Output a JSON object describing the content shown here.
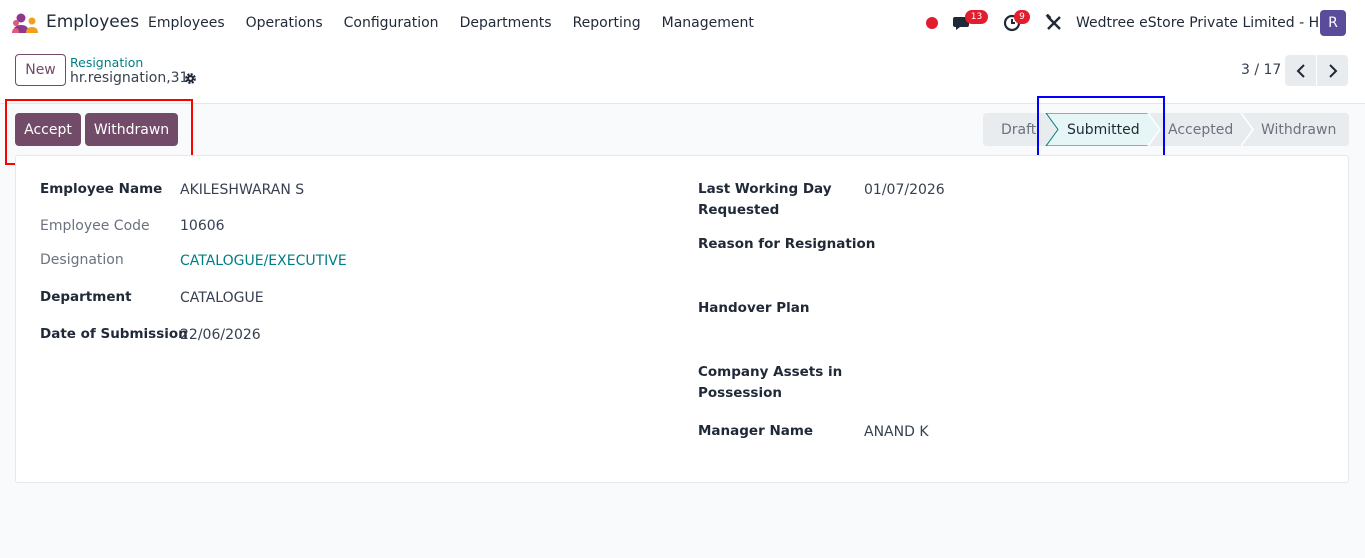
{
  "app": {
    "title": "Employees",
    "icon": "employees-app-icon"
  },
  "menu": [
    "Employees",
    "Operations",
    "Configuration",
    "Departments",
    "Reporting",
    "Management"
  ],
  "systray": {
    "chat_count": "13",
    "activity_count": "9",
    "company": "Wedtree eStore Private Limited - HO",
    "avatar_letter": "R"
  },
  "control_panel": {
    "new_label": "New",
    "breadcrumb_parent": "Resignation",
    "record_name": "hr.resignation,31",
    "pager": "3 / 17"
  },
  "actions": {
    "accept_label": "Accept",
    "withdrawn_label": "Withdrawn"
  },
  "statusbar": {
    "stages": [
      "Draft",
      "Submitted",
      "Accepted",
      "Withdrawn"
    ],
    "active": "Submitted"
  },
  "form": {
    "left": [
      {
        "label": "Employee Name",
        "value": "AKILESHWARAN S"
      },
      {
        "label": "Employee Code",
        "value": "10606"
      },
      {
        "label": "Designation",
        "value": "CATALOGUE/EXECUTIVE"
      },
      {
        "label": "Department",
        "value": "CATALOGUE"
      },
      {
        "label": "Date of Submission",
        "value": "22/06/2026"
      }
    ],
    "right": [
      {
        "label": "Last Working Day",
        "label2": "Requested",
        "value": "01/07/2026"
      },
      {
        "label": "Reason for Resignation",
        "value": ""
      },
      {
        "label": "Handover Plan",
        "value": ""
      },
      {
        "label": "Company Assets in",
        "label2": "Possession",
        "value": ""
      },
      {
        "label": "Manager Name",
        "value": "ANAND K"
      }
    ]
  },
  "colors": {
    "primary": "#714b67",
    "link": "#017e84",
    "badge": "#e11d2e",
    "avatar": "#5b4b9b"
  }
}
